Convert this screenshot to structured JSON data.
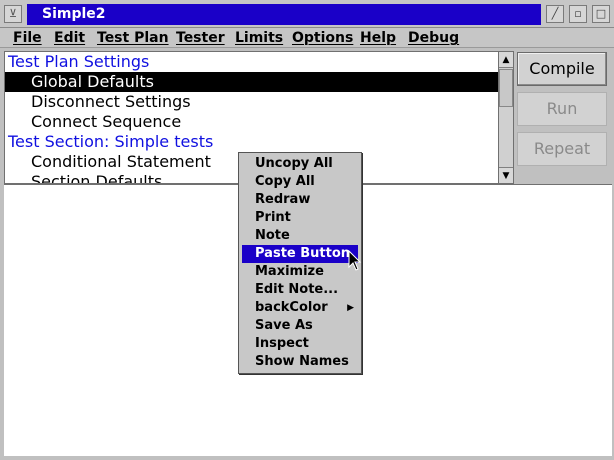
{
  "window": {
    "title": "Simple2"
  },
  "menubar": [
    "File",
    "Edit",
    "Test Plan",
    "Tester",
    "Limits",
    "Options",
    "Help",
    "Debug"
  ],
  "list": {
    "rows": [
      {
        "text": "Test Plan Settings",
        "kind": "header"
      },
      {
        "text": "Global Defaults",
        "kind": "item",
        "selected": true
      },
      {
        "text": "Disconnect Settings",
        "kind": "item"
      },
      {
        "text": "Connect Sequence",
        "kind": "item"
      },
      {
        "text": "Test Section: Simple tests",
        "kind": "header"
      },
      {
        "text": "Conditional Statement",
        "kind": "item"
      },
      {
        "text": "Section Defaults",
        "kind": "item"
      }
    ]
  },
  "buttons": {
    "compile": "Compile",
    "run": "Run",
    "repeat": "Repeat"
  },
  "context_menu": {
    "items": [
      "Uncopy All",
      "Copy All",
      "Redraw",
      "Print",
      "Note",
      "Paste Button",
      "Maximize",
      "Edit Note...",
      "backColor",
      "Save As",
      "Inspect",
      "Show Names"
    ],
    "highlighted": "Paste Button",
    "submenu": "backColor"
  },
  "colors": {
    "title_bar": "#1a00c8",
    "header_text": "#1010e0",
    "highlight": "#1a00c8"
  }
}
